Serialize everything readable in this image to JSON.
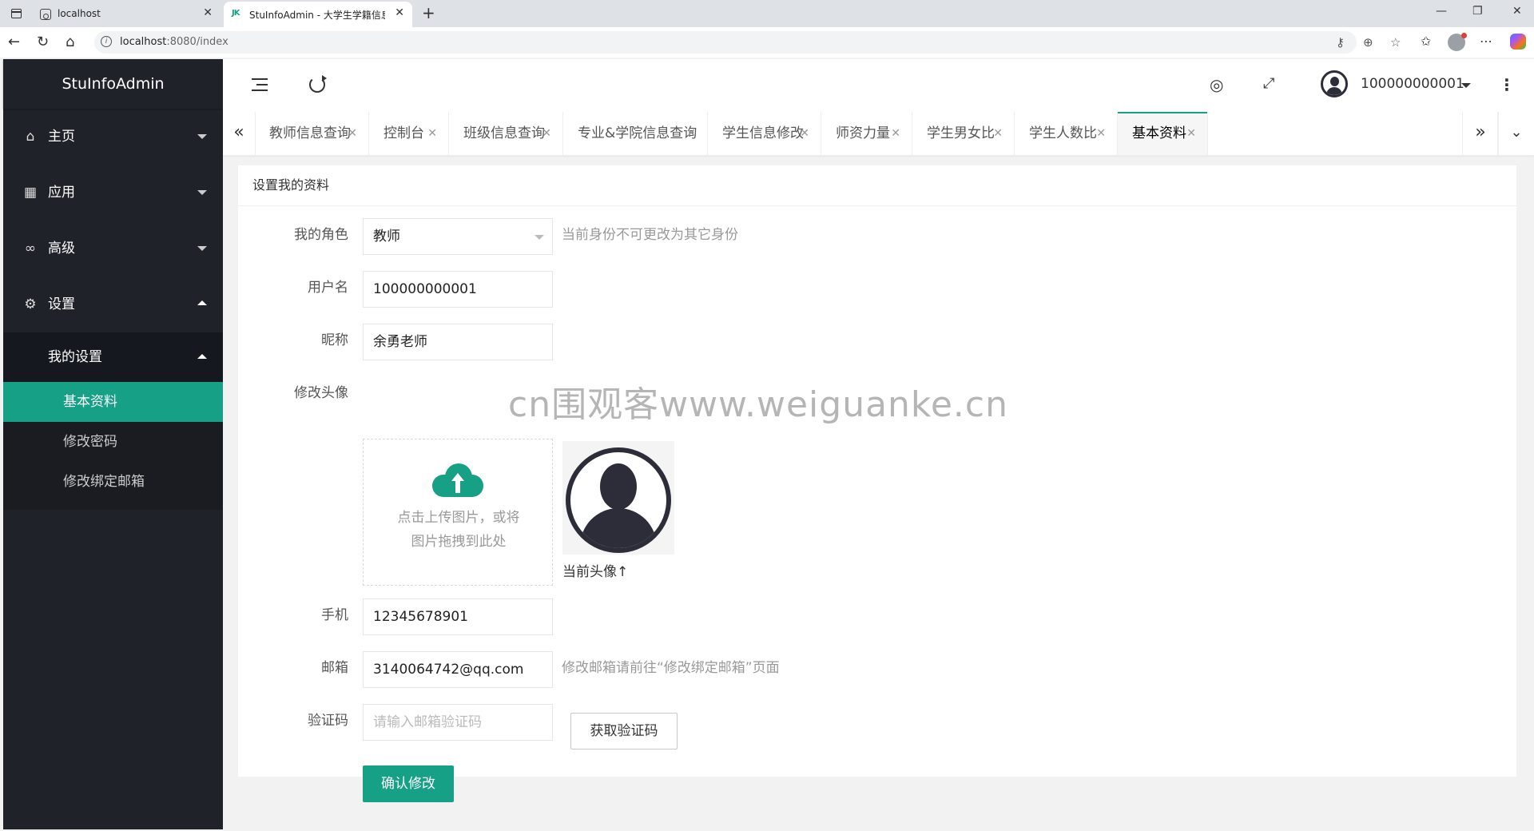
{
  "browser": {
    "tabs": [
      {
        "title": "localhost"
      },
      {
        "title": "StuInfoAdmin - 大学生学籍信息管",
        "favicon": "JK"
      }
    ],
    "url_host": "localhost",
    "url_rest": ":8080/index"
  },
  "app": {
    "logo": "StuInfoAdmin",
    "sidebar": {
      "items": [
        {
          "label": "主页",
          "icon": "home-icon"
        },
        {
          "label": "应用",
          "icon": "apps-icon"
        },
        {
          "label": "高级",
          "icon": "infinity-icon"
        },
        {
          "label": "设置",
          "icon": "gear-icon"
        }
      ],
      "submenu_title": "我的设置",
      "sub_items": [
        {
          "label": "基本资料",
          "active": true
        },
        {
          "label": "修改密码"
        },
        {
          "label": "修改绑定邮箱"
        }
      ]
    },
    "header": {
      "username": "100000000001"
    },
    "page_tabs": [
      {
        "label": "教师信息查询"
      },
      {
        "label": "控制台"
      },
      {
        "label": "班级信息查询"
      },
      {
        "label": "专业&学院信息查询"
      },
      {
        "label": "学生信息修改"
      },
      {
        "label": "师资力量"
      },
      {
        "label": "学生男女比"
      },
      {
        "label": "学生人数比"
      },
      {
        "label": "基本资料",
        "active": true
      }
    ],
    "accent_color": "#16a085"
  },
  "form": {
    "card_title": "设置我的资料",
    "role_label": "我的角色",
    "role_value": "教师",
    "role_hint": "当前身份不可更改为其它身份",
    "username_label": "用户名",
    "username_value": "100000000001",
    "nickname_label": "昵称",
    "nickname_value": "余勇老师",
    "avatar_label": "修改头像",
    "upload_text_1": "点击上传图片，或将",
    "upload_text_2": "图片拖拽到此处",
    "current_avatar_caption": "当前头像↑",
    "phone_label": "手机",
    "phone_value": "12345678901",
    "email_label": "邮箱",
    "email_value": "3140064742@qq.com",
    "email_hint": "修改邮箱请前往“修改绑定邮箱”页面",
    "code_label": "验证码",
    "code_placeholder": "请输入邮箱验证码",
    "get_code_button": "获取验证码",
    "submit_button": "确认修改"
  },
  "watermark": "cn围观客www.weiguanke.cn"
}
